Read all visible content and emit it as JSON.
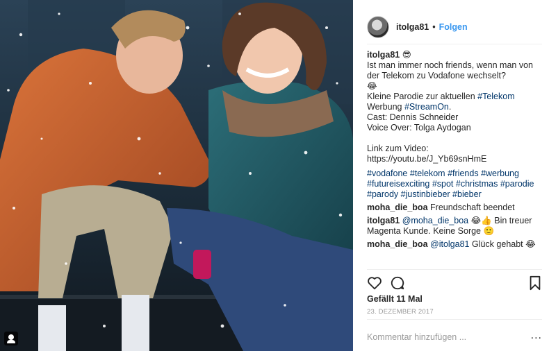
{
  "header": {
    "username": "itolga81",
    "separator": "•",
    "follow_label": "Folgen"
  },
  "caption": {
    "username": "itolga81",
    "emoji_1": "😎",
    "line_1": "Ist man immer noch friends, wenn man von der Telekom zu Vodafone wechselt?",
    "emoji_2": "😂",
    "line_2_prefix": "Kleine Parodie zur aktuellen ",
    "line_2_tag": "#Telekom",
    "line_3_prefix": "Werbung ",
    "line_3_tag": "#StreamOn",
    "line_3_suffix": ".",
    "line_4": "Cast: Dennis Schneider",
    "line_5": "Voice Over: Tolga Aydogan",
    "link_label": "Link zum Video:",
    "link_url": "https://youtu.be/J_Yb69snHmE",
    "hashtags": [
      "#vodafone",
      "#telekom",
      "#friends",
      "#werbung",
      "#futureisexciting",
      "#spot",
      "#christmas",
      "#parodie",
      "#parody",
      "#justinbieber",
      "#bieber"
    ]
  },
  "comments": [
    {
      "user": "moha_die_boa",
      "mention": "",
      "text": "Freundschaft beendet"
    },
    {
      "user": "itolga81",
      "mention": "@moha_die_boa",
      "text": "😂👍 Bin treuer Magenta Kunde. Keine Sorge 🙂"
    },
    {
      "user": "moha_die_boa",
      "mention": "@itolga81",
      "text": "Glück gehabt 😂"
    }
  ],
  "icons": {
    "like": "heart-outline-icon",
    "comment": "speech-bubble-icon",
    "save": "bookmark-icon",
    "photo_badge": "user-tag-icon",
    "more": "ellipsis-icon"
  },
  "likes_label": "Gefällt 11 Mal",
  "date_label": "23. DEZEMBER 2017",
  "add_comment_placeholder": "Kommentar hinzufügen ...",
  "more_label": "...",
  "colors": {
    "link_blue": "#3897f0",
    "hashtag": "#003569",
    "divider": "#efefef",
    "muted": "#999999"
  }
}
